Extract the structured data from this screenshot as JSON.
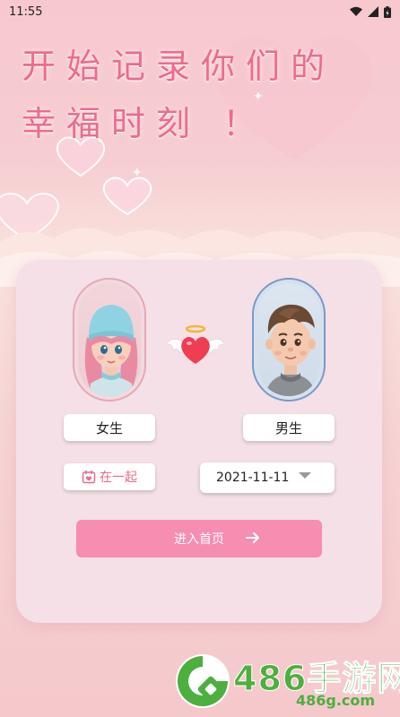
{
  "status_bar": {
    "time": "11:55"
  },
  "title": {
    "line1": "开始记录你们的",
    "line2": "幸福时刻 ！"
  },
  "card": {
    "girl_label": "女生",
    "boy_label": "男生",
    "together_label": "在一起",
    "date_value": "2021-11-11",
    "enter_label": "进入首页"
  },
  "colors": {
    "accent": "#ec6c8c",
    "button_pink": "#f58eb0",
    "card_bg": "#f4e0e6"
  },
  "watermark": {
    "brand": "486手游网",
    "url": "486g.com"
  }
}
